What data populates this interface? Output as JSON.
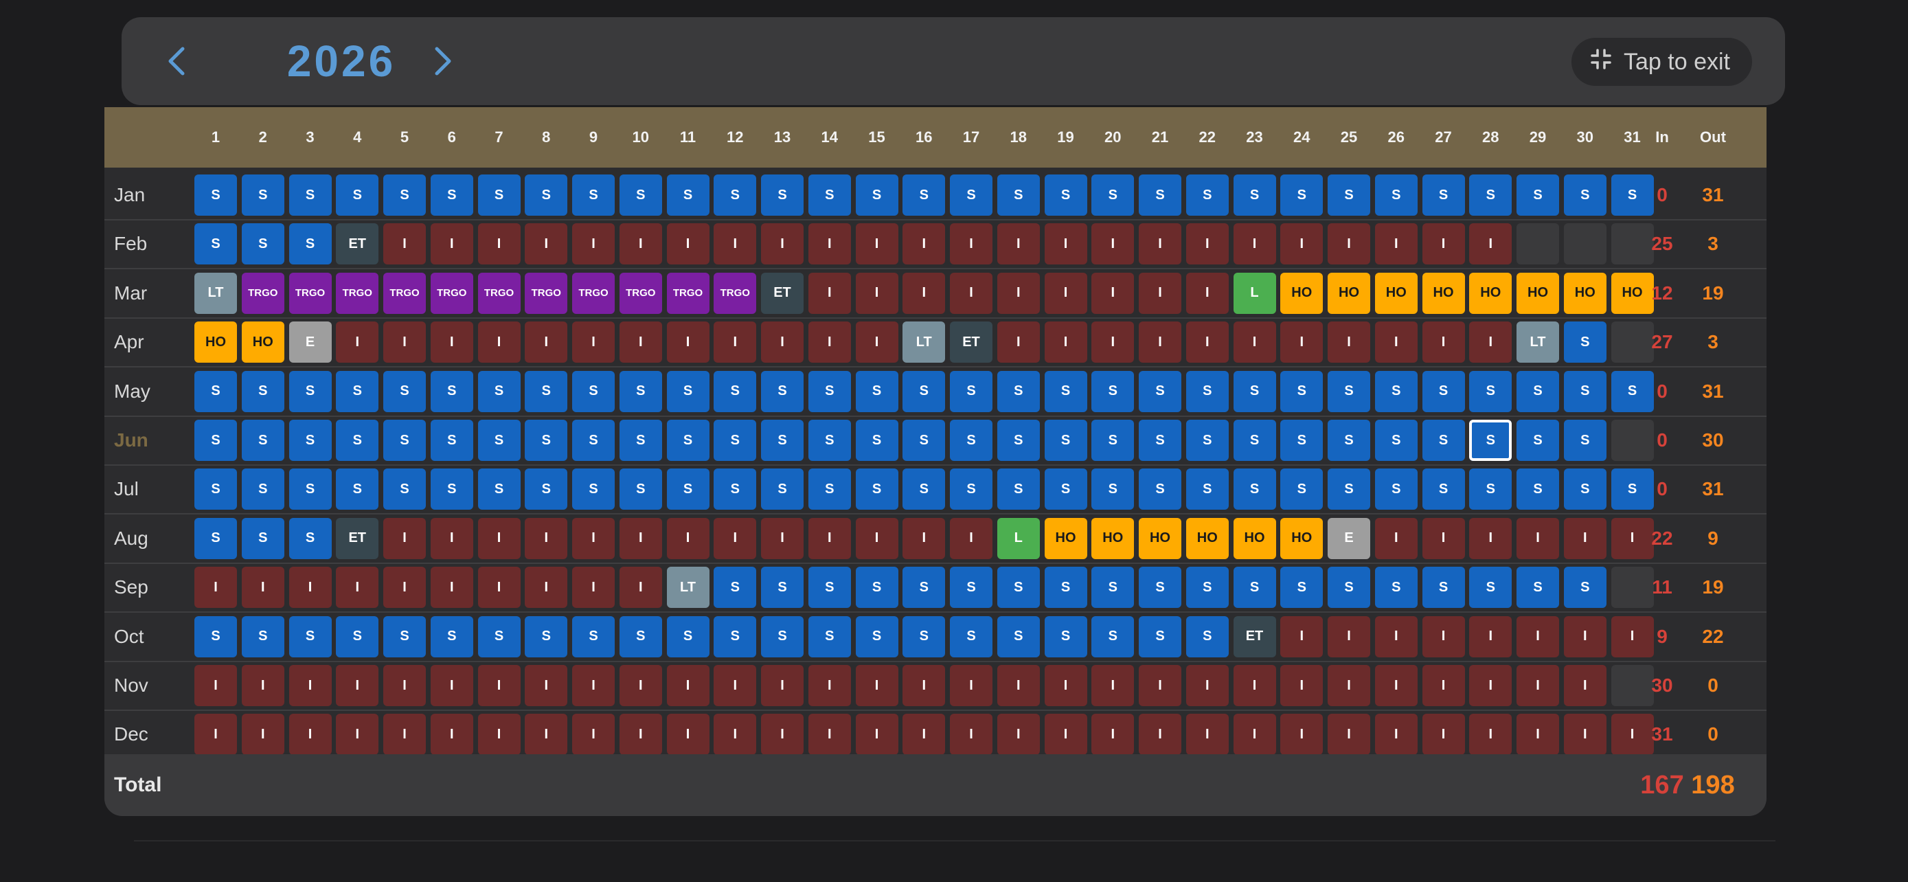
{
  "header": {
    "year": "2026",
    "prev_icon": "chevron-left-icon",
    "next_icon": "chevron-right-icon",
    "exit_label": "Tap to exit",
    "exit_icon": "collapse-icon"
  },
  "columns": {
    "days": [
      "1",
      "2",
      "3",
      "4",
      "5",
      "6",
      "7",
      "8",
      "9",
      "10",
      "11",
      "12",
      "13",
      "14",
      "15",
      "16",
      "17",
      "18",
      "19",
      "20",
      "21",
      "22",
      "23",
      "24",
      "25",
      "26",
      "27",
      "28",
      "29",
      "30",
      "31"
    ],
    "in_label": "In",
    "out_label": "Out"
  },
  "colors": {
    "S": "#1565c0",
    "I": "#6b2b2b",
    "ET": "#37474f",
    "LT": "#78909c",
    "TRGO": "#7b1fa2",
    "HO": "#ffab00",
    "L": "#4caf50",
    "E": "#9e9e9e",
    "in": "#d6423a",
    "out": "#f5851f",
    "header_bg": "#736548",
    "accent": "#5b9bd5"
  },
  "current_month_index": 5,
  "selected_cell": {
    "month": 5,
    "day": 28
  },
  "months": [
    {
      "name": "Jan",
      "days": [
        "S",
        "S",
        "S",
        "S",
        "S",
        "S",
        "S",
        "S",
        "S",
        "S",
        "S",
        "S",
        "S",
        "S",
        "S",
        "S",
        "S",
        "S",
        "S",
        "S",
        "S",
        "S",
        "S",
        "S",
        "S",
        "S",
        "S",
        "S",
        "S",
        "S",
        "S"
      ],
      "in": "0",
      "out": "31"
    },
    {
      "name": "Feb",
      "days": [
        "S",
        "S",
        "S",
        "ET",
        "I",
        "I",
        "I",
        "I",
        "I",
        "I",
        "I",
        "I",
        "I",
        "I",
        "I",
        "I",
        "I",
        "I",
        "I",
        "I",
        "I",
        "I",
        "I",
        "I",
        "I",
        "I",
        "I",
        "I",
        "",
        "",
        ""
      ],
      "in": "25",
      "out": "3"
    },
    {
      "name": "Mar",
      "days": [
        "LT",
        "TRGO",
        "TRGO",
        "TRGO",
        "TRGO",
        "TRGO",
        "TRGO",
        "TRGO",
        "TRGO",
        "TRGO",
        "TRGO",
        "TRGO",
        "ET",
        "I",
        "I",
        "I",
        "I",
        "I",
        "I",
        "I",
        "I",
        "I",
        "L",
        "HO",
        "HO",
        "HO",
        "HO",
        "HO",
        "HO",
        "HO",
        "HO"
      ],
      "in": "12",
      "out": "19"
    },
    {
      "name": "Apr",
      "days": [
        "HO",
        "HO",
        "E",
        "I",
        "I",
        "I",
        "I",
        "I",
        "I",
        "I",
        "I",
        "I",
        "I",
        "I",
        "I",
        "LT",
        "ET",
        "I",
        "I",
        "I",
        "I",
        "I",
        "I",
        "I",
        "I",
        "I",
        "I",
        "I",
        "LT",
        "S",
        ""
      ],
      "in": "27",
      "out": "3"
    },
    {
      "name": "May",
      "days": [
        "S",
        "S",
        "S",
        "S",
        "S",
        "S",
        "S",
        "S",
        "S",
        "S",
        "S",
        "S",
        "S",
        "S",
        "S",
        "S",
        "S",
        "S",
        "S",
        "S",
        "S",
        "S",
        "S",
        "S",
        "S",
        "S",
        "S",
        "S",
        "S",
        "S",
        "S"
      ],
      "in": "0",
      "out": "31"
    },
    {
      "name": "Jun",
      "days": [
        "S",
        "S",
        "S",
        "S",
        "S",
        "S",
        "S",
        "S",
        "S",
        "S",
        "S",
        "S",
        "S",
        "S",
        "S",
        "S",
        "S",
        "S",
        "S",
        "S",
        "S",
        "S",
        "S",
        "S",
        "S",
        "S",
        "S",
        "S",
        "S",
        "S",
        ""
      ],
      "in": "0",
      "out": "30"
    },
    {
      "name": "Jul",
      "days": [
        "S",
        "S",
        "S",
        "S",
        "S",
        "S",
        "S",
        "S",
        "S",
        "S",
        "S",
        "S",
        "S",
        "S",
        "S",
        "S",
        "S",
        "S",
        "S",
        "S",
        "S",
        "S",
        "S",
        "S",
        "S",
        "S",
        "S",
        "S",
        "S",
        "S",
        "S"
      ],
      "in": "0",
      "out": "31"
    },
    {
      "name": "Aug",
      "days": [
        "S",
        "S",
        "S",
        "ET",
        "I",
        "I",
        "I",
        "I",
        "I",
        "I",
        "I",
        "I",
        "I",
        "I",
        "I",
        "I",
        "I",
        "L",
        "HO",
        "HO",
        "HO",
        "HO",
        "HO",
        "HO",
        "E",
        "I",
        "I",
        "I",
        "I",
        "I",
        "I"
      ],
      "in": "22",
      "out": "9"
    },
    {
      "name": "Sep",
      "days": [
        "I",
        "I",
        "I",
        "I",
        "I",
        "I",
        "I",
        "I",
        "I",
        "I",
        "LT",
        "S",
        "S",
        "S",
        "S",
        "S",
        "S",
        "S",
        "S",
        "S",
        "S",
        "S",
        "S",
        "S",
        "S",
        "S",
        "S",
        "S",
        "S",
        "S",
        ""
      ],
      "in": "11",
      "out": "19"
    },
    {
      "name": "Oct",
      "days": [
        "S",
        "S",
        "S",
        "S",
        "S",
        "S",
        "S",
        "S",
        "S",
        "S",
        "S",
        "S",
        "S",
        "S",
        "S",
        "S",
        "S",
        "S",
        "S",
        "S",
        "S",
        "S",
        "ET",
        "I",
        "I",
        "I",
        "I",
        "I",
        "I",
        "I",
        "I"
      ],
      "in": "9",
      "out": "22"
    },
    {
      "name": "Nov",
      "days": [
        "I",
        "I",
        "I",
        "I",
        "I",
        "I",
        "I",
        "I",
        "I",
        "I",
        "I",
        "I",
        "I",
        "I",
        "I",
        "I",
        "I",
        "I",
        "I",
        "I",
        "I",
        "I",
        "I",
        "I",
        "I",
        "I",
        "I",
        "I",
        "I",
        "I",
        ""
      ],
      "in": "30",
      "out": "0"
    },
    {
      "name": "Dec",
      "days": [
        "I",
        "I",
        "I",
        "I",
        "I",
        "I",
        "I",
        "I",
        "I",
        "I",
        "I",
        "I",
        "I",
        "I",
        "I",
        "I",
        "I",
        "I",
        "I",
        "I",
        "I",
        "I",
        "I",
        "I",
        "I",
        "I",
        "I",
        "I",
        "I",
        "I",
        "I"
      ],
      "in": "31",
      "out": "0"
    }
  ],
  "totals": {
    "label": "Total",
    "in": "167",
    "out": "198"
  }
}
